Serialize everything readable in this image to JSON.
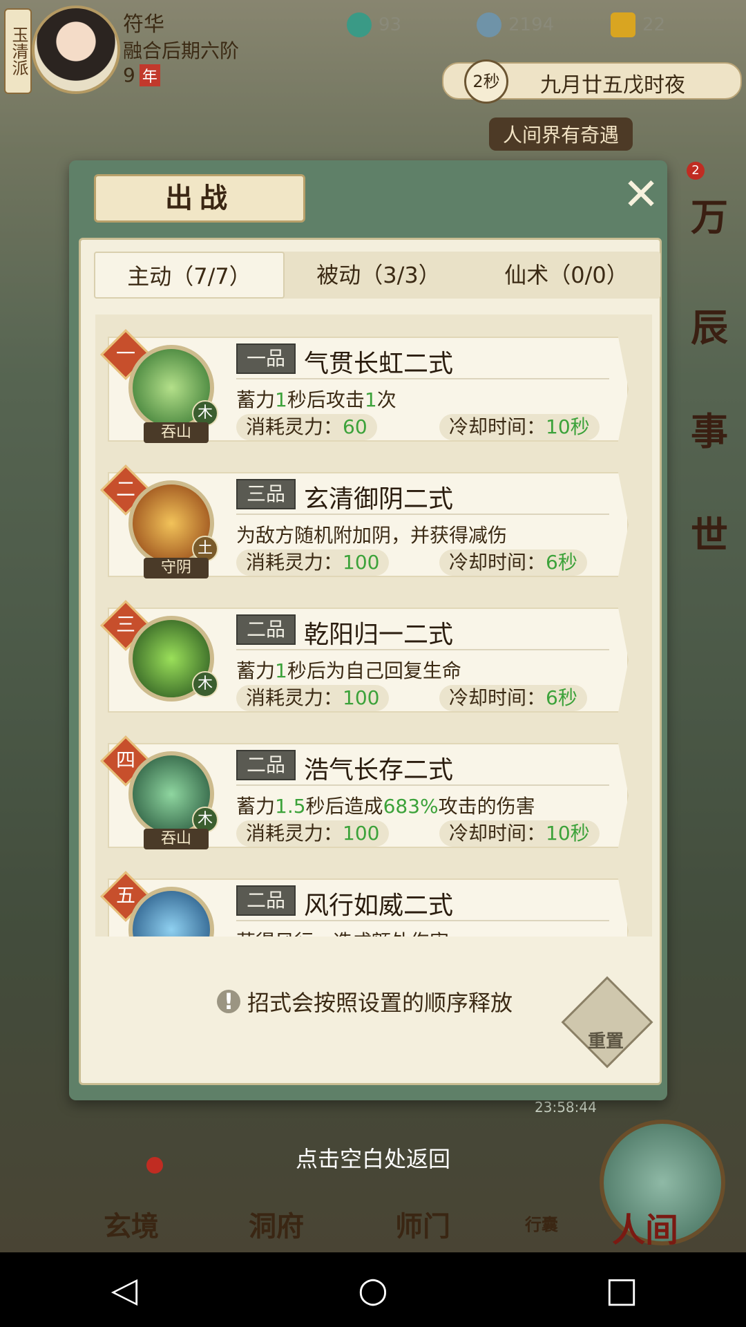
{
  "player": {
    "sect": "玉清派",
    "name": "符华",
    "rank": "融合后期六阶",
    "age_value": "9",
    "age_unit": "年"
  },
  "resources": [
    {
      "icon": "jade-coin-icon",
      "value": "93"
    },
    {
      "icon": "silver-coin-icon",
      "value": "2194"
    },
    {
      "icon": "gold-ingot-icon",
      "value": "22"
    }
  ],
  "game_time": {
    "countdown": "2秒",
    "date": "九月廿五戊时夜"
  },
  "event_banner": "人间界有奇遇",
  "notification_count": "2",
  "side_menu": [
    "万",
    "辰",
    "事",
    "世"
  ],
  "dialog": {
    "title": "出战",
    "tabs": [
      {
        "label": "主动（7/7）",
        "active": true
      },
      {
        "label": "被动（3/3）",
        "active": false
      },
      {
        "label": "仙术（0/0）",
        "active": false
      }
    ],
    "skills": [
      {
        "order": "一",
        "grade": "一品",
        "name": "气贯长虹二式",
        "element": "木",
        "tag": "吞山",
        "desc_parts": [
          "蓄力",
          "1",
          "秒后攻击",
          "1",
          "次"
        ],
        "cost_label": "消耗灵力：",
        "cost": "60",
        "cd_label": "冷却时间：",
        "cd": "10秒",
        "icon_color": "#3c8a3a"
      },
      {
        "order": "二",
        "grade": "三品",
        "name": "玄清御阴二式",
        "element": "土",
        "tag": "守阴",
        "desc_parts": [
          "为敌方随机附加阴，并获得减伤"
        ],
        "cost_label": "消耗灵力：",
        "cost": "100",
        "cd_label": "冷却时间：",
        "cd": "6秒",
        "icon_color": "#c8801e"
      },
      {
        "order": "三",
        "grade": "二品",
        "name": "乾阳归一二式",
        "element": "木",
        "tag": "",
        "desc_parts": [
          "蓄力",
          "1",
          "秒后为自己回复生命"
        ],
        "cost_label": "消耗灵力：",
        "cost": "100",
        "cd_label": "冷却时间：",
        "cd": "6秒",
        "icon_color": "#2f6a2a"
      },
      {
        "order": "四",
        "grade": "二品",
        "name": "浩气长存二式",
        "element": "木",
        "tag": "吞山",
        "desc_parts": [
          "蓄力",
          "1.5",
          "秒后造成",
          "683%",
          "攻击的伤害"
        ],
        "cost_label": "消耗灵力：",
        "cost": "100",
        "cd_label": "冷却时间：",
        "cd": "10秒",
        "icon_color": "#2e7a4a"
      },
      {
        "order": "五",
        "grade": "二品",
        "name": "风行如威二式",
        "element": "",
        "tag": "",
        "desc_parts": [
          "获得风行，造成额外伤害"
        ],
        "cost_label": "",
        "cost": "",
        "cd_label": "",
        "cd": "",
        "icon_color": "#2a6fa0"
      }
    ],
    "hint": "招式会按照设置的顺序释放",
    "reset_label": "重置"
  },
  "back_hint": "点击空白处返回",
  "clock": "23:58:44",
  "bottom_nav": [
    {
      "label": "玄境"
    },
    {
      "label": "洞府"
    },
    {
      "label": "师门"
    },
    {
      "label": "行囊"
    }
  ],
  "world_label": "人间"
}
